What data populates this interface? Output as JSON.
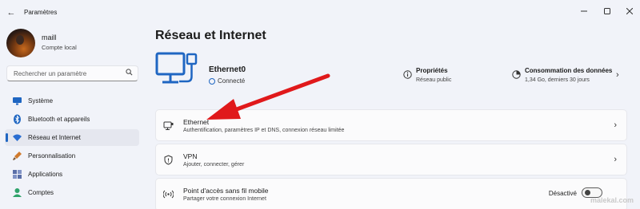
{
  "app": {
    "title": "Paramètres"
  },
  "user": {
    "name": "maill",
    "account_type": "Compte local"
  },
  "search": {
    "placeholder": "Rechercher un paramètre"
  },
  "sidebar": {
    "items": [
      {
        "label": "Système",
        "icon": "monitor-icon",
        "color": "#1f66c2"
      },
      {
        "label": "Bluetooth et appareils",
        "icon": "bluetooth-icon",
        "color": "#1f66c2"
      },
      {
        "label": "Réseau et Internet",
        "icon": "wifi-icon",
        "color": "#2a6ed1",
        "active": true
      },
      {
        "label": "Personnalisation",
        "icon": "brush-icon",
        "color": "#d07a2d"
      },
      {
        "label": "Applications",
        "icon": "apps-icon",
        "color": "#5a6fa8"
      },
      {
        "label": "Comptes",
        "icon": "person-icon",
        "color": "#2fa36b"
      }
    ]
  },
  "page": {
    "title": "Réseau et Internet"
  },
  "hero": {
    "network_name": "Ethernet0",
    "status": "Connecté",
    "properties": {
      "title": "Propriétés",
      "subtitle": "Réseau public"
    },
    "data_usage": {
      "title": "Consommation des données",
      "subtitle": "1,34 Go, derniers 30 jours"
    }
  },
  "cards": [
    {
      "title": "Ethernet",
      "subtitle": "Authentification, paramètres IP et DNS, connexion réseau limitée",
      "icon": "ethernet-icon"
    },
    {
      "title": "VPN",
      "subtitle": "Ajouter, connecter, gérer",
      "icon": "shield-icon"
    },
    {
      "title": "Point d'accès sans fil mobile",
      "subtitle": "Partager votre connexion Internet",
      "icon": "hotspot-icon",
      "toggle_label": "Désactivé",
      "toggle_on": false
    }
  ],
  "watermark": "malekal.com",
  "colors": {
    "accent": "#1f66c2",
    "annotation_arrow": "#e0191b"
  }
}
